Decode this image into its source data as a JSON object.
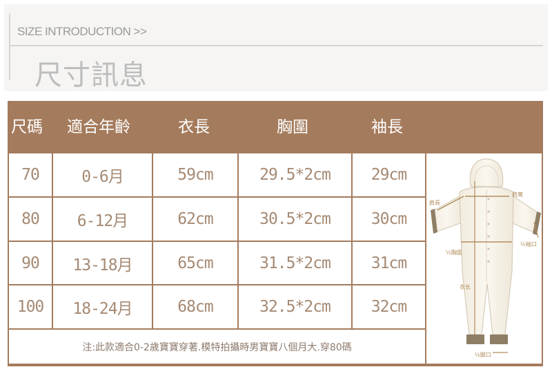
{
  "header": {
    "subtitle": "SIZE INTRODUCTION >>",
    "title": "尺寸訊息"
  },
  "table": {
    "columns": [
      "尺碼",
      "適合年齡",
      "衣長",
      "胸圍",
      "袖長"
    ],
    "rows": [
      [
        "70",
        "0-6月",
        "59cm",
        "29.5*2cm",
        "29cm"
      ],
      [
        "80",
        "6-12月",
        "62cm",
        "30.5*2cm",
        "30cm"
      ],
      [
        "90",
        "13-18月",
        "65cm",
        "31.5*2cm",
        "31cm"
      ],
      [
        "100",
        "18-24月",
        "68cm",
        "32.5*2cm",
        "32cm"
      ]
    ],
    "note": "注:此款適合0-2歲寶寶穿著.模特拍攝時男寶寶八個月大.穿80碼"
  },
  "diagram": {
    "labels": {
      "shoulder_left": "肩長",
      "shoulder_right": "肩寬",
      "chest": "½胸圍",
      "cuff": "½袖口",
      "length": "衣长",
      "leg_opening": "½脚口"
    }
  },
  "colors": {
    "header_bg": "#a47b5c",
    "cell_text": "#a58a74",
    "measure_line": "#b08d5c"
  }
}
